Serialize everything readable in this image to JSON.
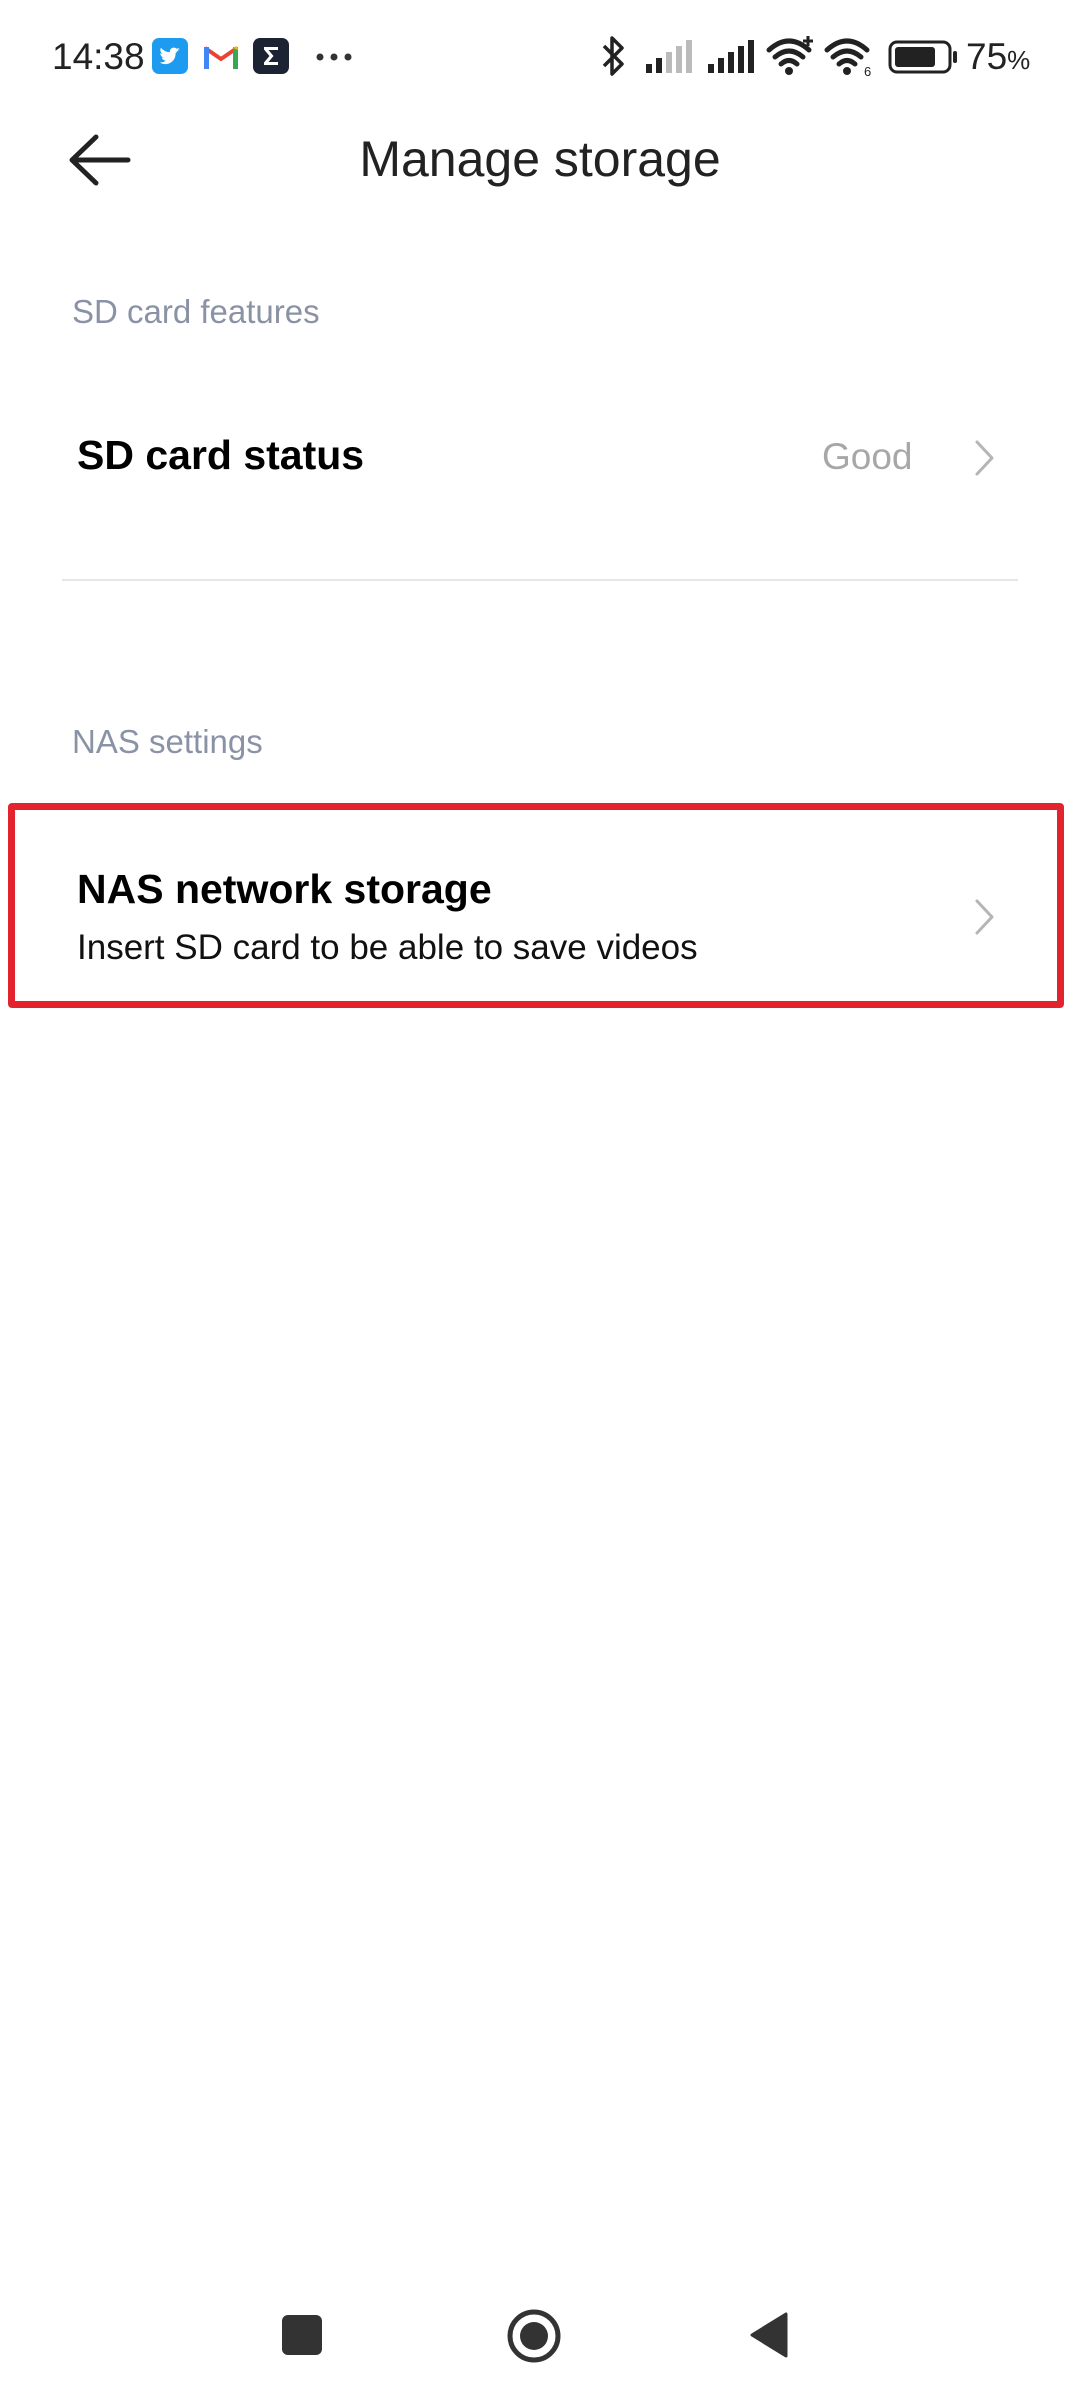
{
  "status_bar": {
    "time": "14:38",
    "battery_percent": "75",
    "battery_unit": "%",
    "notification_icons": [
      "twitter-icon",
      "gmail-icon",
      "sigma-app-icon",
      "more-dots-icon"
    ],
    "system_icons": [
      "bluetooth-icon",
      "signal-icon",
      "signal-icon",
      "wifi-icon",
      "wifi-6-icon",
      "battery-icon"
    ]
  },
  "header": {
    "title": "Manage storage",
    "back_icon": "arrow-left-icon"
  },
  "sd_section": {
    "label": "SD card features",
    "item_title": "SD card status",
    "item_value": "Good"
  },
  "nas_section": {
    "label": "NAS settings",
    "item_title": "NAS network storage",
    "item_subtitle": "Insert SD card to be able to save videos"
  },
  "nav_bar": {
    "buttons": [
      "recents-square-icon",
      "home-circle-icon",
      "back-triangle-icon"
    ]
  },
  "colors": {
    "highlight": "#e3242f",
    "section_label": "#8a93a6",
    "value_text": "#a7a7a7"
  }
}
